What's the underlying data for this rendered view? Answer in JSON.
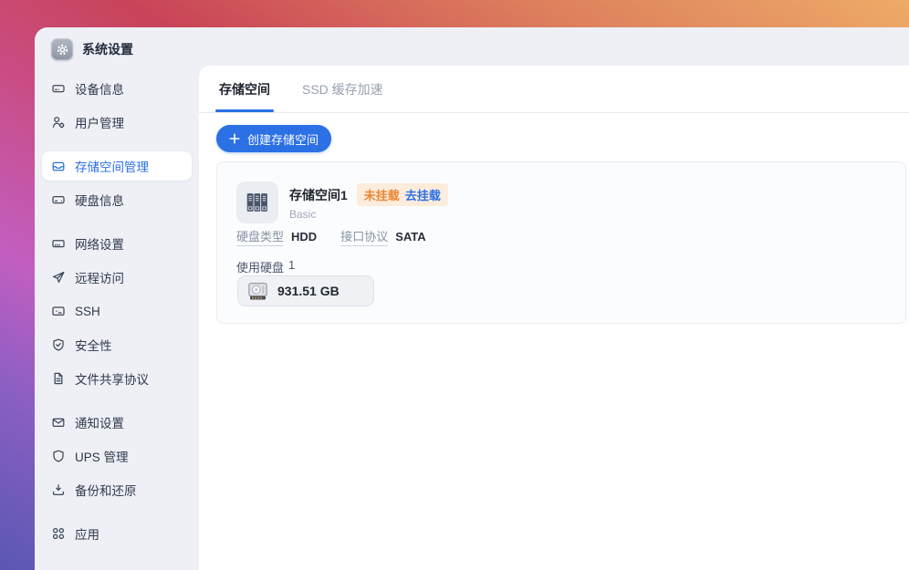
{
  "window": {
    "title": "系统设置"
  },
  "sidebar": {
    "items": [
      {
        "label": "设备信息",
        "icon": "server-icon"
      },
      {
        "label": "用户管理",
        "icon": "user-gear-icon"
      },
      {
        "label": "存储空间管理",
        "icon": "storage-inbox-icon",
        "selected": true
      },
      {
        "label": "硬盘信息",
        "icon": "hard-disk-icon"
      },
      {
        "label": "网络设置",
        "icon": "network-device-icon"
      },
      {
        "label": "远程访问",
        "icon": "paper-plane-icon"
      },
      {
        "label": "SSH",
        "icon": "terminal-icon"
      },
      {
        "label": "安全性",
        "icon": "shield-check-icon"
      },
      {
        "label": "文件共享协议",
        "icon": "document-icon"
      },
      {
        "label": "通知设置",
        "icon": "envelope-icon"
      },
      {
        "label": "UPS 管理",
        "icon": "shield-icon"
      },
      {
        "label": "备份和还原",
        "icon": "download-tray-icon"
      },
      {
        "label": "应用",
        "icon": "apps-grid-icon"
      }
    ]
  },
  "tabs": [
    {
      "label": "存储空间",
      "active": true
    },
    {
      "label": "SSD 缓存加速",
      "active": false
    }
  ],
  "toolbar": {
    "create_button_label": "创建存储空间"
  },
  "storage_card": {
    "name": "存储空间1",
    "status_badge": "未挂载",
    "action_link": "去挂载",
    "type": "Basic",
    "specs": [
      {
        "label": "硬盘类型",
        "value": "HDD"
      },
      {
        "label": "接口协议",
        "value": "SATA"
      }
    ],
    "disks_label": "使用硬盘",
    "disks_count": "1",
    "disk_chip": {
      "capacity": "931.51 GB"
    }
  },
  "colors": {
    "accent_blue": "#2b70e4",
    "status_orange": "#ec8531",
    "badge_bg": "#fcecdc",
    "sidebar_bg": "#eef0f6",
    "selected_item_bg": "#ffffff",
    "card_bg": "#fbfcfe",
    "wallpaper_bottom_left": "#5a57b4",
    "wallpaper_magenta": "#c25ec1",
    "wallpaper_top_right": "#eeab67"
  }
}
